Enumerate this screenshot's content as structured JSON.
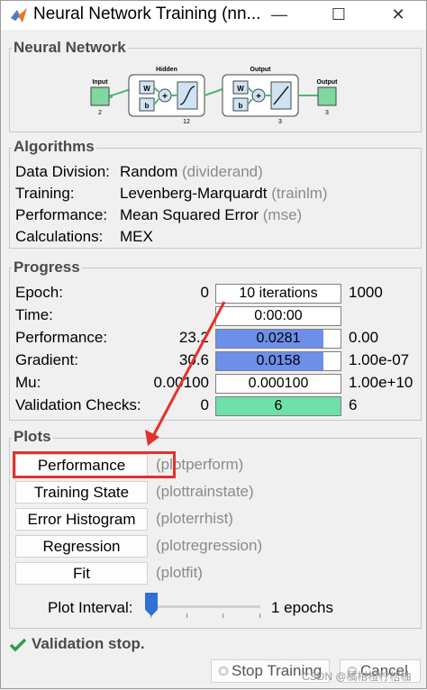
{
  "window": {
    "title": "Neural Network Training (nn...",
    "minimize": "—",
    "maximize": "☐",
    "close": "✕"
  },
  "network": {
    "title": "Neural Network",
    "input_label": "Input",
    "input_size": "2",
    "hidden_label": "Hidden",
    "hidden_size": "12",
    "output_label": "Output",
    "output_size": "3",
    "final_output_label": "Output",
    "final_output_size": "3",
    "w_label": "W",
    "b_label": "b",
    "plus": "+"
  },
  "algorithms": {
    "title": "Algorithms",
    "rows": [
      {
        "label": "Data Division:",
        "value": "Random",
        "fn": "(dividerand)"
      },
      {
        "label": "Training:",
        "value": "Levenberg-Marquardt",
        "fn": "(trainlm)"
      },
      {
        "label": "Performance:",
        "value": "Mean Squared Error",
        "fn": "(mse)"
      },
      {
        "label": "Calculations:",
        "value": "MEX",
        "fn": ""
      }
    ]
  },
  "progress": {
    "title": "Progress",
    "rows": [
      {
        "label": "Epoch:",
        "min": "0",
        "value": "10 iterations",
        "max": "1000",
        "fill": 0,
        "color": "#6d8fea"
      },
      {
        "label": "Time:",
        "min": "",
        "value": "0:00:00",
        "max": "",
        "fill": 0,
        "color": "#6d8fea"
      },
      {
        "label": "Performance:",
        "min": "23.2",
        "value": "0.0281",
        "max": "0.00",
        "fill": 0.86,
        "color": "#6d8fea"
      },
      {
        "label": "Gradient:",
        "min": "30.6",
        "value": "0.0158",
        "max": "1.00e-07",
        "fill": 0.86,
        "color": "#6d8fea"
      },
      {
        "label": "Mu:",
        "min": "0.00100",
        "value": "0.000100",
        "max": "1.00e+10",
        "fill": 0,
        "color": "#6d8fea"
      },
      {
        "label": "Validation Checks:",
        "min": "0",
        "value": "6",
        "max": "6",
        "fill": 1.0,
        "color": "#6fe0a8"
      }
    ]
  },
  "plots": {
    "title": "Plots",
    "buttons": [
      {
        "label": "Performance",
        "fn": "(plotperform)"
      },
      {
        "label": "Training State",
        "fn": "(plottrainstate)"
      },
      {
        "label": "Error Histogram",
        "fn": "(ploterrhist)"
      },
      {
        "label": "Regression",
        "fn": "(plotregression)"
      },
      {
        "label": "Fit",
        "fn": "(plotfit)"
      }
    ],
    "interval_label": "Plot Interval:",
    "interval_value": "1 epochs",
    "interval_fraction": 0.0
  },
  "status": {
    "icon": "checkmark-icon",
    "text": "Validation stop."
  },
  "footer": {
    "stop_label": "Stop Training",
    "cancel_label": "Cancel",
    "watermark": "CSDN @橘柑橙柠桔柚"
  },
  "colors": {
    "progress_blue": "#6d8fea",
    "progress_green": "#6fe0a8",
    "highlight_red": "#e4312b",
    "layer_box": "#cfe3f3",
    "io_green": "#7fd8a0"
  }
}
